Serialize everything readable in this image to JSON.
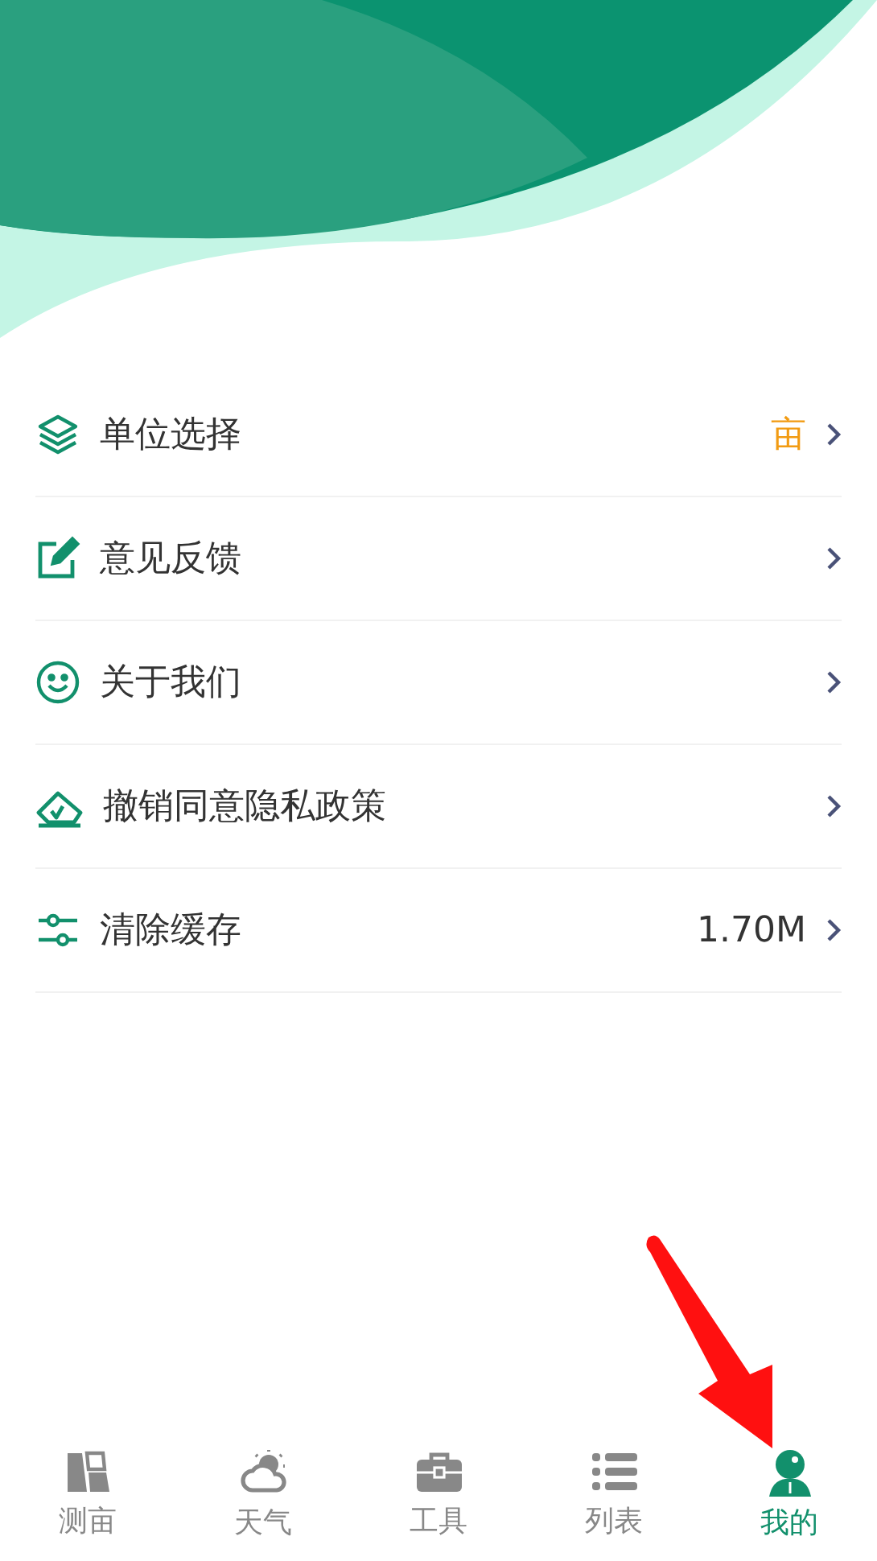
{
  "menu": [
    {
      "label": "单位选择",
      "value": "亩",
      "color": "#f29b12"
    },
    {
      "label": "意见反馈"
    },
    {
      "label": "关于我们"
    },
    {
      "label": "撤销同意隐私政策"
    },
    {
      "label": "清除缓存",
      "value": "1.70M",
      "color": "#333333"
    }
  ],
  "tabs": [
    {
      "label": "测亩",
      "selected": false
    },
    {
      "label": "天气",
      "selected": false
    },
    {
      "label": "工具",
      "selected": false
    },
    {
      "label": "列表",
      "selected": false
    },
    {
      "label": "我的",
      "selected": true
    }
  ]
}
